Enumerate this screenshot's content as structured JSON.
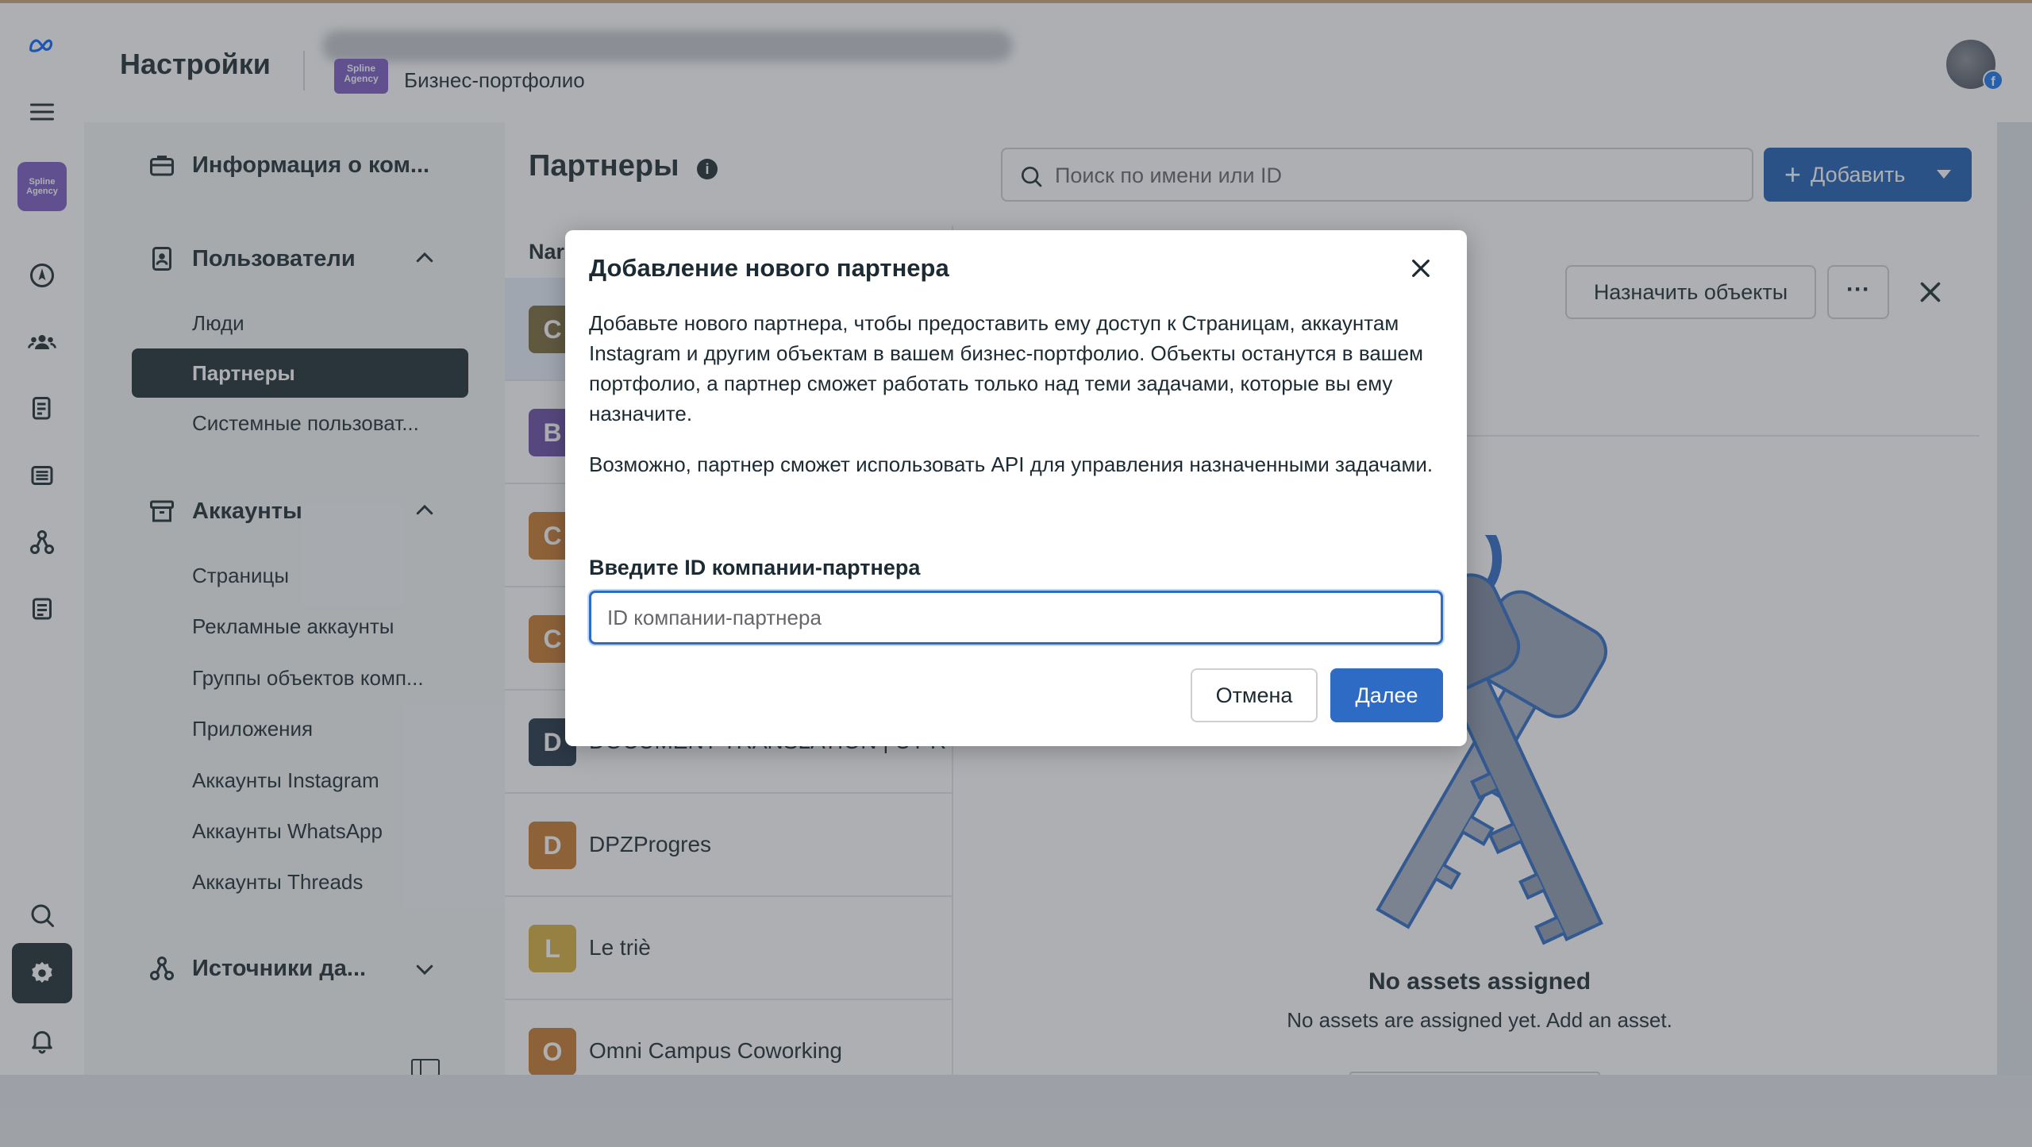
{
  "header": {
    "title": "Настройки",
    "portfolio_badge": "Spline Agency",
    "portfolio_label": "Бизнес-портфолио"
  },
  "rail": {
    "logo_text": "Spline Agency",
    "icons": [
      "menu-icon",
      "compass-icon",
      "people-icon",
      "document-icon",
      "catalog-icon",
      "integrations-icon",
      "billing-icon",
      "search-icon",
      "gear-icon",
      "bell-icon"
    ]
  },
  "nav": {
    "company_info": "Информация о ком...",
    "users_section": "Пользователи",
    "users_items": [
      "Люди",
      "Партнеры",
      "Системные пользоват..."
    ],
    "accounts_section": "Аккаунты",
    "accounts_items": [
      "Страницы",
      "Рекламные аккаунты",
      "Группы объектов комп...",
      "Приложения",
      "Аккаунты Instagram",
      "Аккаунты WhatsApp",
      "Аккаунты Threads"
    ],
    "data_sources_section": "Источники да..."
  },
  "main": {
    "title": "Партнеры",
    "search_placeholder": "Поиск по имени или ID",
    "add_button": "Добавить",
    "list_header": "Nar",
    "rows": [
      {
        "letter": "C",
        "name": "",
        "color": "#7a6a3a"
      },
      {
        "letter": "B",
        "name": "",
        "color": "#6a4fa8"
      },
      {
        "letter": "C",
        "name": "",
        "color": "#c97a30"
      },
      {
        "letter": "C",
        "name": "",
        "color": "#c97a30"
      },
      {
        "letter": "D",
        "name": "DOCUMENT TRANSLATION | UT R",
        "color": "#243447"
      },
      {
        "letter": "D",
        "name": "DPZProgres",
        "color": "#c97a30"
      },
      {
        "letter": "L",
        "name": "Le triè",
        "color": "#d8b040"
      },
      {
        "letter": "O",
        "name": "Omni Campus Coworking",
        "color": "#c97a30"
      }
    ],
    "assign_button": "Назначить объекты",
    "more_button": "···",
    "empty_title": "No assets assigned",
    "empty_subtitle": "No assets are assigned yet. Add an asset."
  },
  "modal": {
    "title": "Добавление нового партнера",
    "paragraph1": "Добавьте нового партнера, чтобы предоставить ему доступ к Страницам, аккаунтам Instagram и другим объектам в вашем бизнес-портфолио. Объекты останутся в вашем портфолио, а партнер сможет работать только над теми задачами, которые вы ему назначите.",
    "paragraph2": "Возможно, партнер сможет использовать API для управления назначенными задачами.",
    "field_label": "Введите ID компании-партнера",
    "field_placeholder": "ID компании-партнера",
    "field_value": "",
    "cancel_button": "Отмена",
    "next_button": "Далее"
  },
  "colors": {
    "primary": "#2d6bc4",
    "dark": "#1c2b33",
    "brand": "#7b5cc4"
  }
}
